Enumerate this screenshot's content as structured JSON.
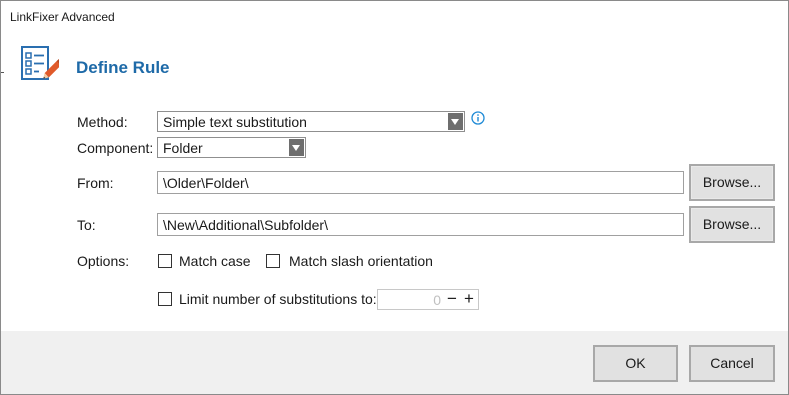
{
  "window": {
    "title": "LinkFixer Advanced"
  },
  "header": {
    "title": "Define Rule",
    "icon": "rule-list-icon"
  },
  "form": {
    "method_label": "Method:",
    "method_value": "Simple text substitution",
    "component_label": "Component:",
    "component_value": "Folder",
    "from_label": "From:",
    "from_value": "\\Older\\Folder\\",
    "to_label": "To:",
    "to_value": "\\New\\Additional\\Subfolder\\",
    "browse_label": "Browse...",
    "options_label": "Options:",
    "match_case_label": "Match case",
    "match_case_checked": false,
    "match_slash_label": "Match slash orientation",
    "match_slash_checked": false,
    "limit_label": "Limit number of substitutions to:",
    "limit_checked": false,
    "limit_value": "0",
    "minus_label": "−",
    "plus_label": "+"
  },
  "footer": {
    "ok_label": "OK",
    "cancel_label": "Cancel"
  },
  "colors": {
    "accent": "#1e6aa8",
    "footer_bg": "#f0f0f0",
    "button_bg": "#e1e1e1",
    "info_icon": "#1e8ad6",
    "icon_pencil": "#e05a2a"
  }
}
